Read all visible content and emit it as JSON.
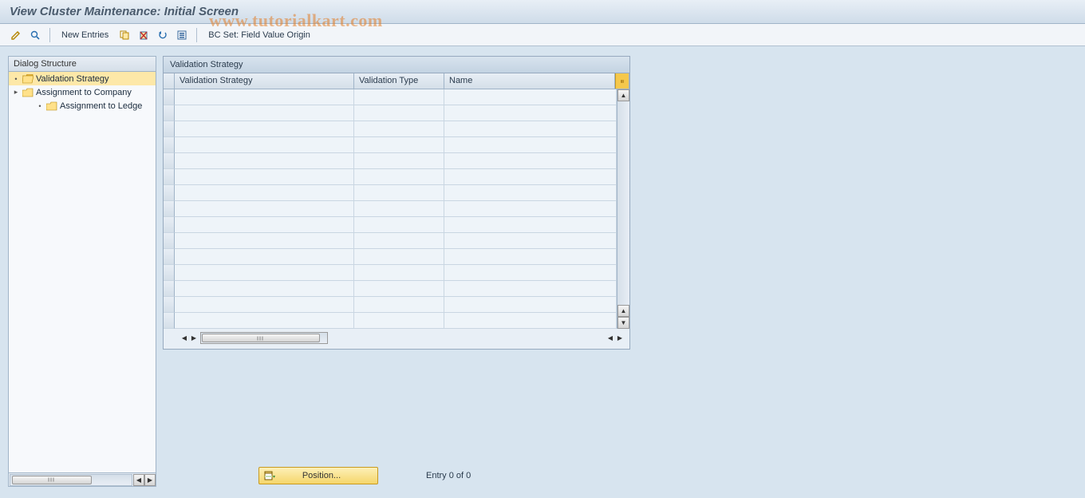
{
  "title": "View Cluster Maintenance: Initial Screen",
  "toolbar": {
    "new_entries": "New Entries",
    "bcset": "BC Set: Field Value Origin"
  },
  "tree": {
    "header": "Dialog Structure",
    "nodes": [
      {
        "label": "Validation Strategy"
      },
      {
        "label": "Assignment to Company"
      },
      {
        "label": "Assignment to Ledge"
      }
    ]
  },
  "grid": {
    "title": "Validation Strategy",
    "columns": [
      "Validation Strategy",
      "Validation Type",
      "Name"
    ]
  },
  "bottom": {
    "position_label": "Position...",
    "entry_text": "Entry 0 of 0"
  },
  "watermark": "www.tutorialkart.com"
}
